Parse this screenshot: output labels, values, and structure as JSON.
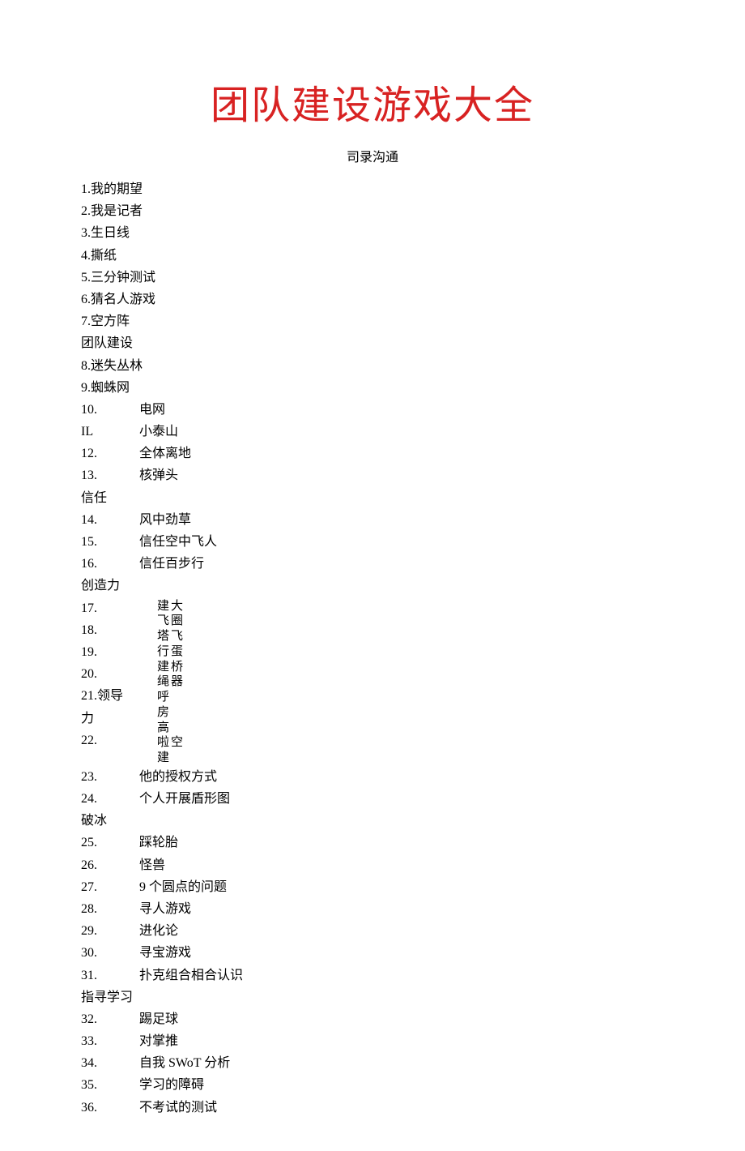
{
  "title": "团队建设游戏大全",
  "subtitle": "司录沟通",
  "items_part1": [
    {
      "num": "1.",
      "text": "我的期望",
      "short": true
    },
    {
      "num": "2.",
      "text": "我是记者",
      "short": true
    },
    {
      "num": "3.",
      "text": "生日线",
      "short": true
    },
    {
      "num": "4.",
      "text": "撕纸",
      "short": true
    },
    {
      "num": "5.",
      "text": "三分钟测试",
      "short": true
    },
    {
      "num": "6.",
      "text": "猜名人游戏",
      "short": true
    },
    {
      "num": "7.",
      "text": "空方阵",
      "short": true
    }
  ],
  "section1": "团队建设",
  "items_part2": [
    {
      "num": "8.",
      "text": "迷失丛林",
      "short": true
    },
    {
      "num": "9.",
      "text": "蜘蛛网",
      "short": true
    },
    {
      "num": "10.",
      "text": "电网",
      "short": false
    },
    {
      "num": "IL",
      "text": "小泰山",
      "short": false
    },
    {
      "num": "12.",
      "text": "全体离地",
      "short": false
    },
    {
      "num": "13.",
      "text": "核弹头",
      "short": false
    }
  ],
  "section2": "信任",
  "items_part3": [
    {
      "num": "14.",
      "text": "风中劲草",
      "short": false
    },
    {
      "num": "15.",
      "text": "信任空中飞人",
      "short": false
    },
    {
      "num": "16.",
      "text": "信任百步行",
      "short": false
    }
  ],
  "section3": "创造力",
  "creative_block": {
    "left_nums": [
      "17.",
      "18.",
      "19.",
      "20.",
      "21.领导",
      "力",
      "22."
    ],
    "col1": [
      "建",
      "飞",
      "塔",
      "行",
      "建",
      "绳",
      "呼",
      "房",
      "高",
      "啦",
      "建"
    ],
    "col2": [
      "大",
      "圈",
      "飞",
      "蛋",
      "桥",
      "器",
      "",
      "",
      "",
      "空",
      ""
    ]
  },
  "items_part4": [
    {
      "num": "23.",
      "text": "他的授权方式",
      "short": false
    },
    {
      "num": "24.",
      "text": "个人开展盾形图",
      "short": false
    }
  ],
  "section4": "破冰",
  "items_part5": [
    {
      "num": "25.",
      "text": "踩轮胎",
      "short": false
    },
    {
      "num": "26.",
      "text": "怪兽",
      "short": false
    },
    {
      "num": "27.",
      "text": "9 个圆点的问题",
      "short": false
    },
    {
      "num": "28.",
      "text": "寻人游戏",
      "short": false
    },
    {
      "num": "29.",
      "text": "进化论",
      "short": false
    },
    {
      "num": "30.",
      "text": "寻宝游戏",
      "short": false
    },
    {
      "num": "31.",
      "text": "扑克组合相合认识",
      "short": false
    }
  ],
  "section5": "指寻学习",
  "items_part6": [
    {
      "num": "32.",
      "text": "踢足球",
      "short": false
    },
    {
      "num": "33.",
      "text": "对掌推",
      "short": false
    },
    {
      "num": "34.",
      "text": "自我 SWoT 分析",
      "short": false
    },
    {
      "num": "35.",
      "text": "学习的障碍",
      "short": false
    },
    {
      "num": "36.",
      "text": "不考试的测试",
      "short": false
    }
  ]
}
